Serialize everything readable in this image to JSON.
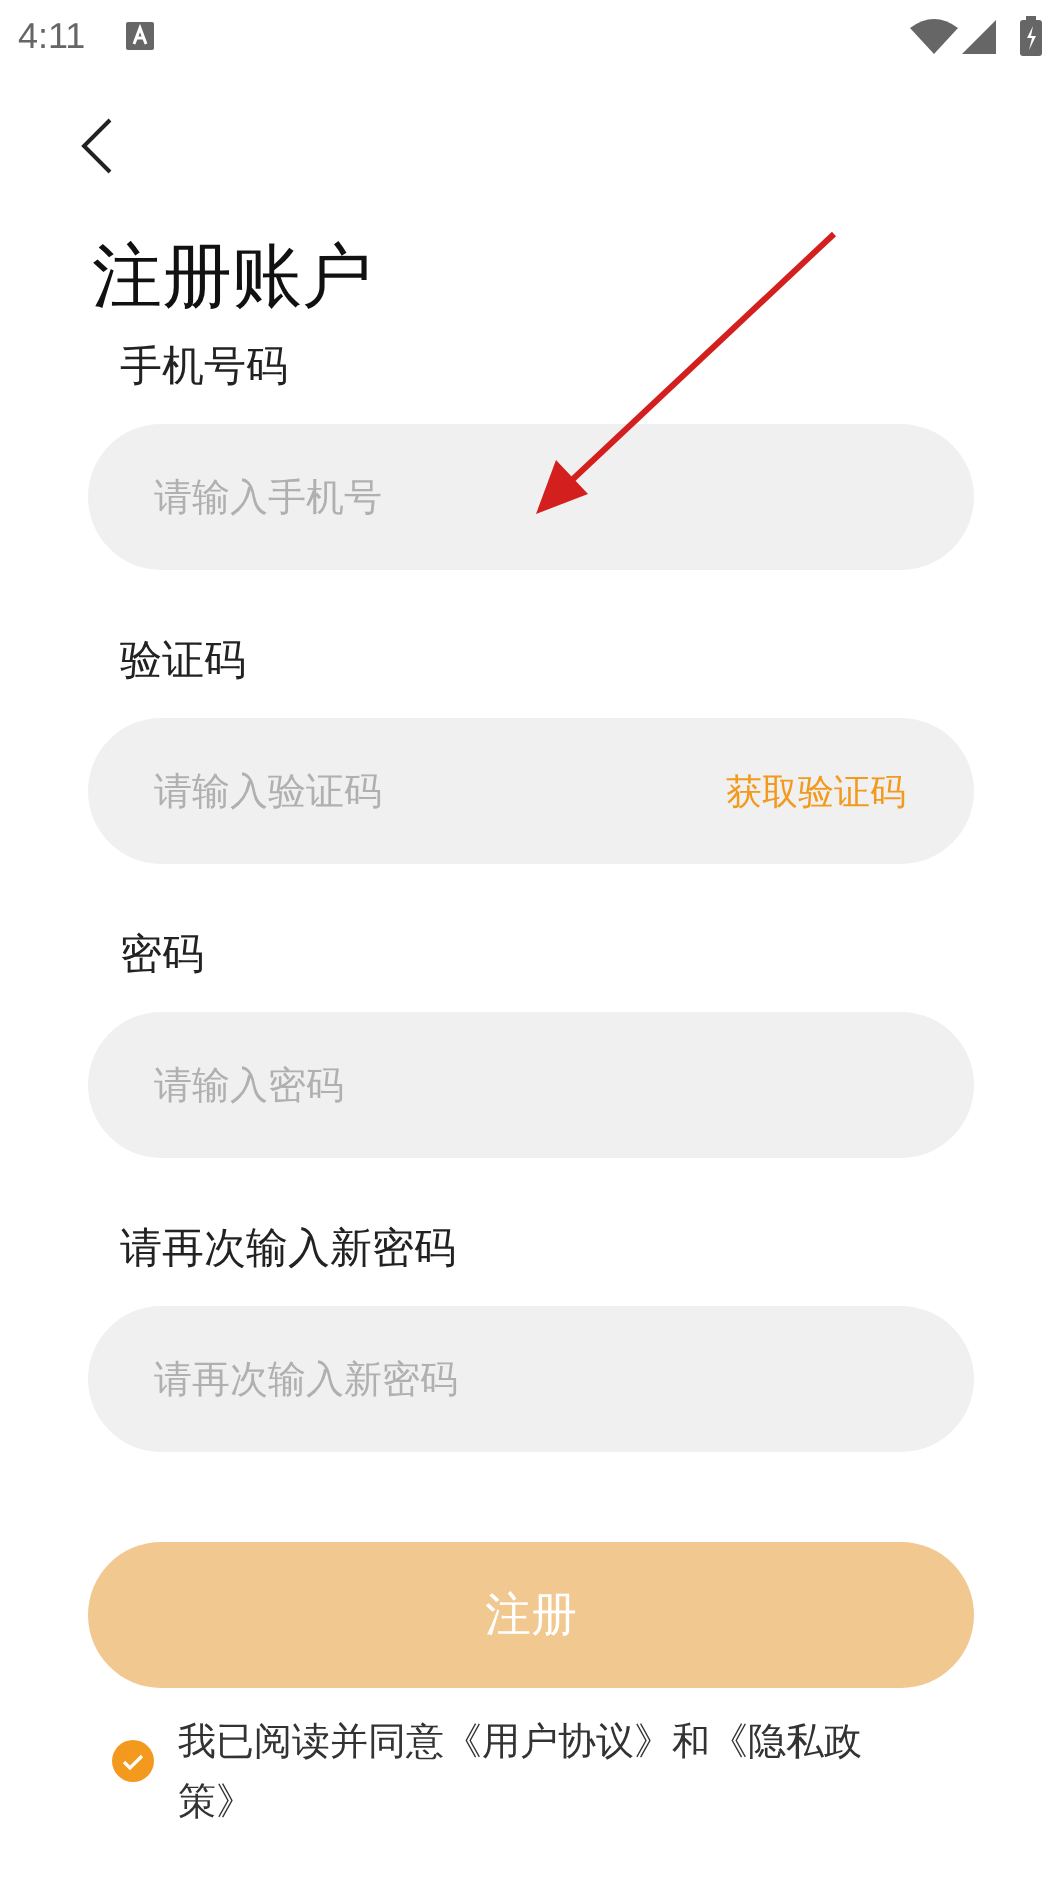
{
  "status_bar": {
    "time": "4:11"
  },
  "title": "注册账户",
  "fields": [
    {
      "label": "手机号码",
      "placeholder": "请输入手机号"
    },
    {
      "label": "验证码",
      "placeholder": "请输入验证码",
      "action": "获取验证码"
    },
    {
      "label": "密码",
      "placeholder": "请输入密码"
    },
    {
      "label": "请再次输入新密码",
      "placeholder": "请再次输入新密码"
    }
  ],
  "submit": {
    "label": "注册",
    "disabled": true
  },
  "agreement": {
    "checked": true,
    "text": "我已阅读并同意《用户协议》和《隐私政策》"
  }
}
